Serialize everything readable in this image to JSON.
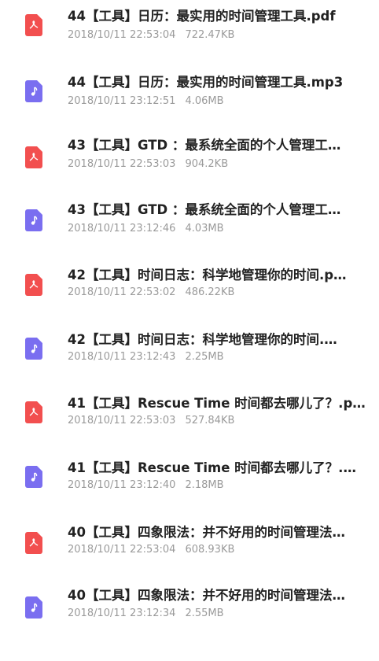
{
  "files": [
    {
      "type": "pdf",
      "icon": "pdf-icon",
      "name": "44【工具】日历：最实用的时间管理工具.pdf",
      "date": "2018/10/11 22:53:04",
      "size": "722.47KB"
    },
    {
      "type": "mp3",
      "icon": "music-note-icon",
      "name": "44【工具】日历：最实用的时间管理工具.mp3",
      "date": "2018/10/11 23:12:51",
      "size": "4.06MB"
    },
    {
      "type": "pdf",
      "icon": "pdf-icon",
      "name": "43【工具】GTD ：最系统全面的个人管理工…",
      "date": "2018/10/11 22:53:03",
      "size": "904.2KB"
    },
    {
      "type": "mp3",
      "icon": "music-note-icon",
      "name": "43【工具】GTD ：最系统全面的个人管理工…",
      "date": "2018/10/11 23:12:46",
      "size": "4.03MB"
    },
    {
      "type": "pdf",
      "icon": "pdf-icon",
      "name": "42【工具】时间日志：科学地管理你的时间.p…",
      "date": "2018/10/11 22:53:02",
      "size": "486.22KB"
    },
    {
      "type": "mp3",
      "icon": "music-note-icon",
      "name": "42【工具】时间日志：科学地管理你的时间.…",
      "date": "2018/10/11 23:12:43",
      "size": "2.25MB"
    },
    {
      "type": "pdf",
      "icon": "pdf-icon",
      "name": "41【工具】Rescue Time 时间都去哪儿了？.p…",
      "date": "2018/10/11 22:53:03",
      "size": "527.84KB"
    },
    {
      "type": "mp3",
      "icon": "music-note-icon",
      "name": "41【工具】Rescue Time 时间都去哪儿了？.…",
      "date": "2018/10/11 23:12:40",
      "size": "2.18MB"
    },
    {
      "type": "pdf",
      "icon": "pdf-icon",
      "name": "40【工具】四象限法：并不好用的时间管理法…",
      "date": "2018/10/11 22:53:04",
      "size": "608.93KB"
    },
    {
      "type": "mp3",
      "icon": "music-note-icon",
      "name": "40【工具】四象限法：并不好用的时间管理法…",
      "date": "2018/10/11 23:12:34",
      "size": "2.55MB"
    }
  ]
}
